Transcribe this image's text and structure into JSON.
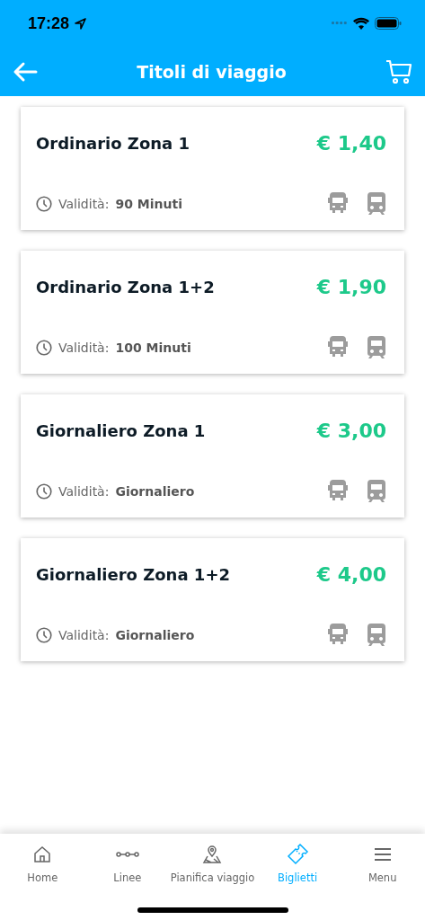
{
  "status_bar": {
    "time": "17:28"
  },
  "header": {
    "title": "Titoli di viaggio"
  },
  "tickets": [
    {
      "name": "Ordinario Zona 1",
      "price": "€ 1,40",
      "validity_label": "Validità:",
      "validity": "90 Minuti"
    },
    {
      "name": "Ordinario Zona 1+2",
      "price": "€ 1,90",
      "validity_label": "Validità:",
      "validity": "100 Minuti"
    },
    {
      "name": "Giornaliero Zona 1",
      "price": "€ 3,00",
      "validity_label": "Validità:",
      "validity": "Giornaliero"
    },
    {
      "name": "Giornaliero Zona 1+2",
      "price": "€ 4,00",
      "validity_label": "Validità:",
      "validity": "Giornaliero"
    }
  ],
  "tab_bar": [
    {
      "kind": "home",
      "label": "Home",
      "selected": false
    },
    {
      "kind": "lines",
      "label": "Linee",
      "selected": false
    },
    {
      "kind": "map",
      "label": "Pianifica viaggio",
      "selected": false
    },
    {
      "kind": "ticket",
      "label": "Biglietti",
      "selected": true
    },
    {
      "kind": "menu",
      "label": "Menu",
      "selected": false
    }
  ]
}
